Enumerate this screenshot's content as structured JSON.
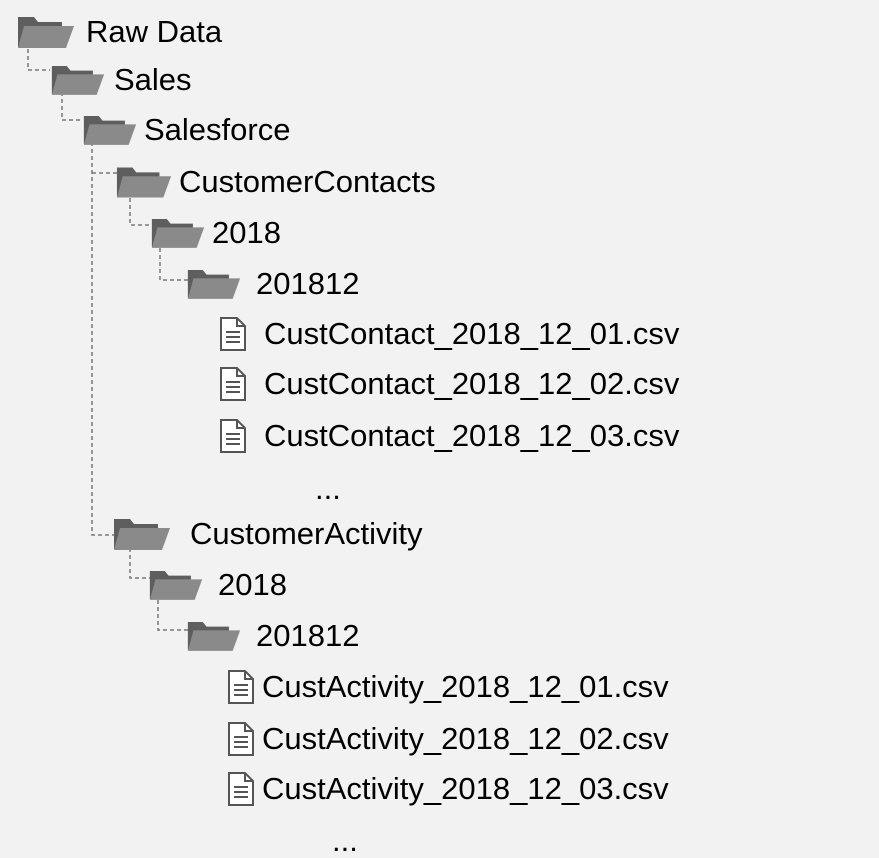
{
  "colors": {
    "background": "#f2f2f2",
    "folder": "#8a8a8a",
    "folder_dark": "#5e5e5e",
    "file_outline": "#555555",
    "connector": "#777777"
  },
  "tree": {
    "root": {
      "label": "Raw Data",
      "icon": "folder-icon"
    },
    "sales": {
      "label": "Sales",
      "icon": "folder-icon"
    },
    "salesforce": {
      "label": "Salesforce",
      "icon": "folder-icon"
    },
    "contacts": {
      "label": "CustomerContacts",
      "icon": "folder-icon",
      "year": {
        "label": "2018",
        "icon": "folder-icon"
      },
      "month": {
        "label": "201812",
        "icon": "folder-icon"
      },
      "files": [
        {
          "label": "CustContact_2018_12_01.csv",
          "icon": "file-icon"
        },
        {
          "label": "CustContact_2018_12_02.csv",
          "icon": "file-icon"
        },
        {
          "label": "CustContact_2018_12_03.csv",
          "icon": "file-icon"
        }
      ],
      "more": "..."
    },
    "activity": {
      "label": "CustomerActivity",
      "icon": "folder-icon",
      "year": {
        "label": "2018",
        "icon": "folder-icon"
      },
      "month": {
        "label": "201812",
        "icon": "folder-icon"
      },
      "files": [
        {
          "label": "CustActivity_2018_12_01.csv",
          "icon": "file-icon"
        },
        {
          "label": "CustActivity_2018_12_02.csv",
          "icon": "file-icon"
        },
        {
          "label": "CustActivity_2018_12_03.csv",
          "icon": "file-icon"
        }
      ],
      "more": "..."
    }
  }
}
